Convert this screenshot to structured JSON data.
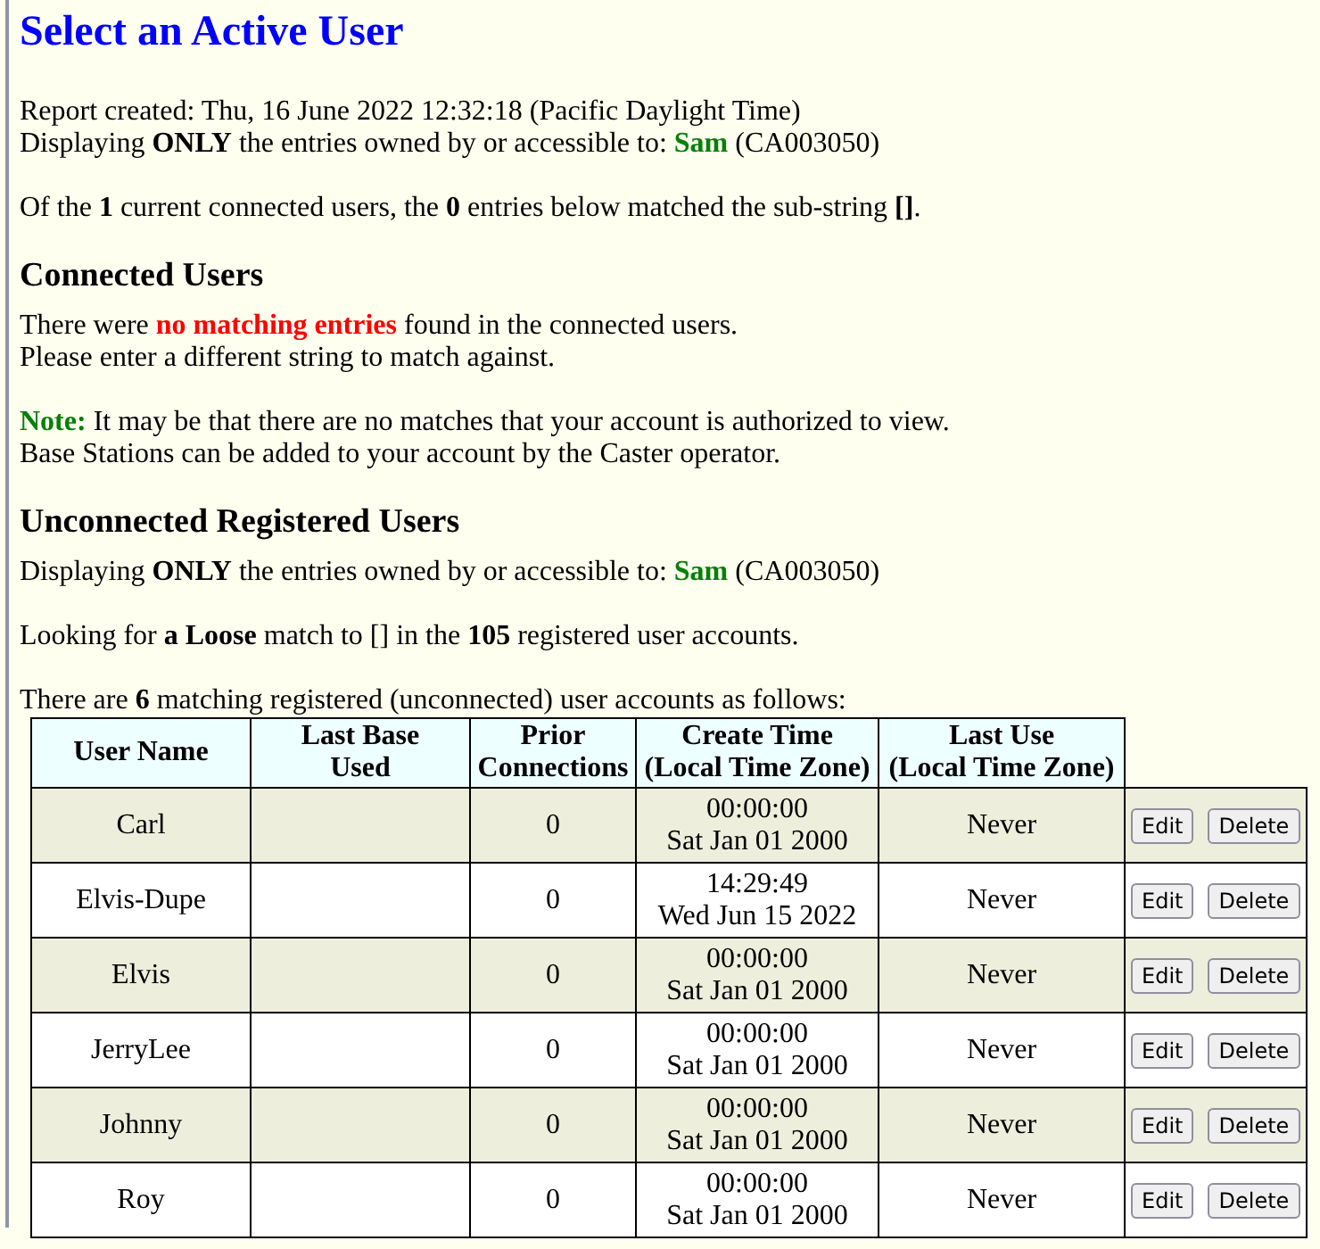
{
  "title": "Select an Active User",
  "report_lines": [
    [
      {
        "t": "Report created: Thu, 16 June 2022 12:32:18 (Pacific Daylight Time)",
        "kind": "plain"
      }
    ],
    [
      {
        "t": "Displaying ",
        "kind": "plain"
      },
      {
        "t": "ONLY",
        "kind": "bold"
      },
      {
        "t": " the entries owned by or accessible to: ",
        "kind": "plain"
      },
      {
        "t": "Sam",
        "kind": "green"
      },
      {
        "t": " (CA003050)",
        "kind": "plain"
      }
    ]
  ],
  "summary": [
    {
      "t": "Of the ",
      "kind": "plain"
    },
    {
      "t": "1",
      "kind": "bold"
    },
    {
      "t": " current connected users, the ",
      "kind": "plain"
    },
    {
      "t": "0",
      "kind": "bold"
    },
    {
      "t": " entries below matched the sub-string ",
      "kind": "plain"
    },
    {
      "t": "[]",
      "kind": "bold"
    },
    {
      "t": ".",
      "kind": "plain"
    }
  ],
  "connected": {
    "heading": "Connected Users",
    "message": [
      [
        {
          "t": "There were ",
          "kind": "plain"
        },
        {
          "t": "no matching entries",
          "kind": "red"
        },
        {
          "t": " found in the connected users.",
          "kind": "plain"
        }
      ],
      [
        {
          "t": "Please enter a different string to match against.",
          "kind": "plain"
        }
      ]
    ],
    "note": [
      [
        {
          "t": "Note:",
          "kind": "green"
        },
        {
          "t": " It may be that there are no matches that your account is authorized to view.",
          "kind": "plain"
        }
      ],
      [
        {
          "t": "Base Stations can be added to your account by the Caster operator.",
          "kind": "plain"
        }
      ]
    ]
  },
  "unconnected": {
    "heading": "Unconnected Registered Users",
    "owner_line": [
      {
        "t": "Displaying ",
        "kind": "plain"
      },
      {
        "t": "ONLY",
        "kind": "bold"
      },
      {
        "t": " the entries owned by or accessible to: ",
        "kind": "plain"
      },
      {
        "t": "Sam",
        "kind": "green"
      },
      {
        "t": " (CA003050)",
        "kind": "plain"
      }
    ],
    "search_line": [
      {
        "t": "Looking for ",
        "kind": "plain"
      },
      {
        "t": "a Loose",
        "kind": "bold"
      },
      {
        "t": " match to [] in the ",
        "kind": "plain"
      },
      {
        "t": "105",
        "kind": "bold"
      },
      {
        "t": " registered user accounts.",
        "kind": "plain"
      }
    ],
    "count_line": [
      {
        "t": "There are ",
        "kind": "plain"
      },
      {
        "t": "6",
        "kind": "bold"
      },
      {
        "t": " matching registered (unconnected) user accounts as follows:",
        "kind": "plain"
      }
    ]
  },
  "table": {
    "columns": [
      [
        "User Name"
      ],
      [
        "Last Base",
        "Used"
      ],
      [
        "Prior",
        "Connections"
      ],
      [
        "Create Time",
        "(Local Time Zone)"
      ],
      [
        "Last Use",
        "(Local Time Zone)"
      ]
    ],
    "rows": [
      {
        "shaded": true,
        "user": "Carl",
        "prior": "0",
        "created": [
          "00:00:00",
          "Sat Jan 01 2000"
        ],
        "last_use": "Never",
        "actions": [
          "Edit",
          "Delete"
        ]
      },
      {
        "shaded": false,
        "user": "Elvis-Dupe",
        "prior": "0",
        "created": [
          "14:29:49",
          "Wed Jun 15 2022"
        ],
        "last_use": "Never",
        "actions": [
          "Edit",
          "Delete"
        ]
      },
      {
        "shaded": true,
        "user": "Elvis",
        "prior": "0",
        "created": [
          "00:00:00",
          "Sat Jan 01 2000"
        ],
        "last_use": "Never",
        "actions": [
          "Edit",
          "Delete"
        ]
      },
      {
        "shaded": false,
        "user": "JerryLee",
        "prior": "0",
        "created": [
          "00:00:00",
          "Sat Jan 01 2000"
        ],
        "last_use": "Never",
        "actions": [
          "Edit",
          "Delete"
        ]
      },
      {
        "shaded": true,
        "user": "Johnny",
        "prior": "0",
        "created": [
          "00:00:00",
          "Sat Jan 01 2000"
        ],
        "last_use": "Never",
        "actions": [
          "Edit",
          "Delete"
        ]
      },
      {
        "shaded": false,
        "user": "Roy",
        "prior": "0",
        "created": [
          "00:00:00",
          "Sat Jan 01 2000"
        ],
        "last_use": "Never",
        "actions": [
          "Edit",
          "Delete"
        ]
      }
    ]
  }
}
